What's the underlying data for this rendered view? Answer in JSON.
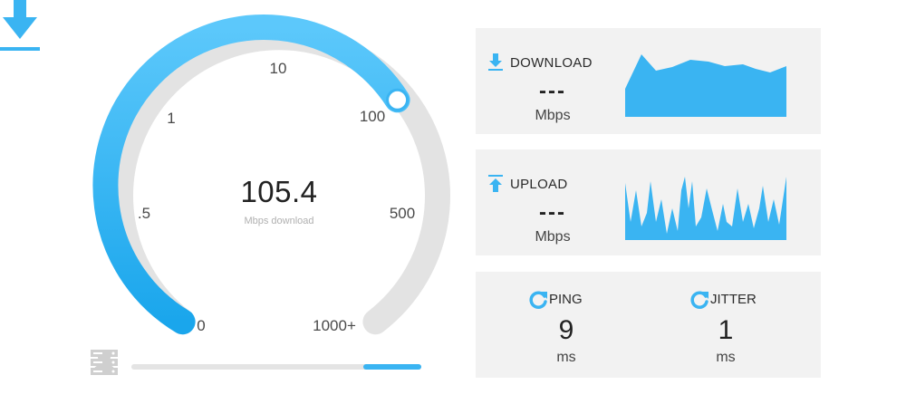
{
  "gauge": {
    "ticks": {
      "t0": "0",
      "t05": ".5",
      "t1": "1",
      "t10": "10",
      "t100": "100",
      "t500": "500",
      "t1000": "1000+"
    },
    "speed": "105.4",
    "unit_label": "Mbps download",
    "accent": "#3ab4f2",
    "track_color": "#e3e3e3"
  },
  "progress": {
    "fill_fraction_start": 0.8,
    "fill_fraction_end": 1.0
  },
  "download": {
    "label": "DOWNLOAD",
    "value": "---",
    "unit": "Mbps"
  },
  "upload": {
    "label": "UPLOAD",
    "value": "---",
    "unit": "Mbps"
  },
  "ping": {
    "label": "PING",
    "value": "9",
    "unit": "ms"
  },
  "jitter": {
    "label": "JITTER",
    "value": "1",
    "unit": "ms"
  },
  "icons": [
    "download-arrow-icon",
    "user-icon",
    "server-icon",
    "upload-arrow-icon",
    "refresh-icon"
  ]
}
